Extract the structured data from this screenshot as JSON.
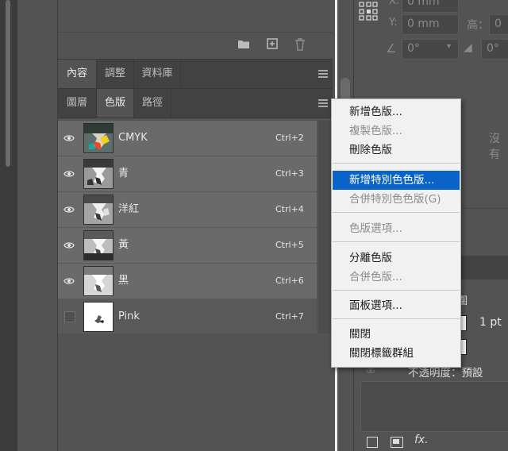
{
  "tabs_top": [
    {
      "label": "內容",
      "active": true
    },
    {
      "label": "調整",
      "active": false
    },
    {
      "label": "資料庫",
      "active": false
    }
  ],
  "tabs_panel": [
    {
      "label": "圖層",
      "active": false
    },
    {
      "label": "色版",
      "active": true
    },
    {
      "label": "路徑",
      "active": false
    }
  ],
  "channels": [
    {
      "name": "CMYK",
      "shortcut": "Ctrl+2",
      "visible": true
    },
    {
      "name": "青",
      "shortcut": "Ctrl+3",
      "visible": true
    },
    {
      "name": "洋紅",
      "shortcut": "Ctrl+4",
      "visible": true
    },
    {
      "name": "黃",
      "shortcut": "Ctrl+5",
      "visible": true
    },
    {
      "name": "黑",
      "shortcut": "Ctrl+6",
      "visible": true
    },
    {
      "name": "Pink",
      "shortcut": "Ctrl+7",
      "visible": false
    }
  ],
  "context_menu": {
    "items": [
      {
        "label": "新增色版...",
        "enabled": true,
        "highlighted": false
      },
      {
        "label": "複製色版...",
        "enabled": false,
        "highlighted": false
      },
      {
        "label": "刪除色版",
        "enabled": true,
        "highlighted": false
      },
      {
        "label": "新增特別色色版...",
        "enabled": true,
        "highlighted": true
      },
      {
        "label": "合併特別色色版(G)",
        "enabled": false,
        "highlighted": false
      },
      {
        "label": "色版選項...",
        "enabled": false,
        "highlighted": false
      },
      {
        "label": "分離色版",
        "enabled": true,
        "highlighted": false
      },
      {
        "label": "合併色版...",
        "enabled": false,
        "highlighted": false
      },
      {
        "label": "面板選項...",
        "enabled": true,
        "highlighted": false
      },
      {
        "label": "關閉",
        "enabled": true,
        "highlighted": false
      },
      {
        "label": "關閉標籤群組",
        "enabled": true,
        "highlighted": false
      }
    ]
  },
  "properties": {
    "x_label": "X:",
    "x_value": "0 mm",
    "y_label": "Y:",
    "y_value": "0 mm",
    "h_label": "高：",
    "h_value": "0",
    "angle_value": "0°",
    "skew_value": "0°",
    "no_prop_text": "沒有",
    "stroke_value": "1 pt",
    "partial_label": "圍",
    "opacity_text": "不透明度：預設"
  },
  "colors": {
    "highlight": "#0a63c9",
    "panel_bg": "#535353",
    "row_bg": "#6a6a6a",
    "menu_bg": "#f1f1f1"
  }
}
